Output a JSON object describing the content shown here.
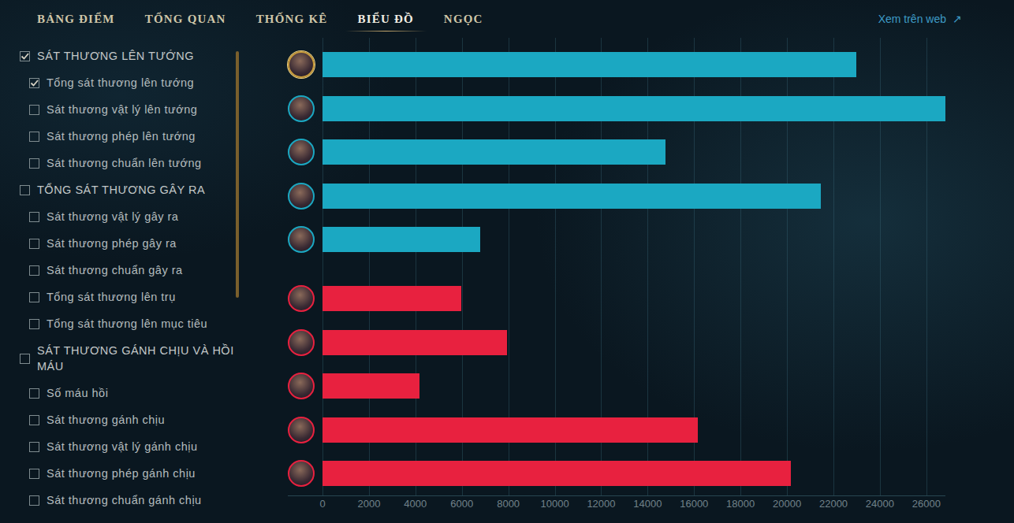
{
  "tabs": [
    {
      "label": "BẢNG ĐIỂM",
      "selected": false
    },
    {
      "label": "TỔNG QUAN",
      "selected": false
    },
    {
      "label": "THỐNG KÊ",
      "selected": false
    },
    {
      "label": "BIỂU ĐỒ",
      "selected": true
    },
    {
      "label": "NGỌC",
      "selected": false
    }
  ],
  "web_link": {
    "label": "Xem trên web",
    "icon": "↗"
  },
  "sidebar": {
    "items": [
      {
        "label": "SÁT THƯƠNG LÊN TƯỚNG",
        "kind": "group",
        "checked": true
      },
      {
        "label": "Tổng sát thương lên tướng",
        "kind": "item",
        "checked": true
      },
      {
        "label": "Sát thương vật lý lên tướng",
        "kind": "item",
        "checked": false
      },
      {
        "label": "Sát thương phép lên tướng",
        "kind": "item",
        "checked": false
      },
      {
        "label": "Sát thương chuẩn lên tướng",
        "kind": "item",
        "checked": false
      },
      {
        "label": "TỔNG SÁT THƯƠNG GÂY RA",
        "kind": "group",
        "checked": false
      },
      {
        "label": "Sát thương vật lý gây ra",
        "kind": "item",
        "checked": false
      },
      {
        "label": "Sát thương phép gây ra",
        "kind": "item",
        "checked": false
      },
      {
        "label": "Sát thương chuẩn gây ra",
        "kind": "item",
        "checked": false
      },
      {
        "label": "Tổng sát thương lên trụ",
        "kind": "item",
        "checked": false
      },
      {
        "label": "Tổng sát thương lên mục tiêu",
        "kind": "item",
        "checked": false
      },
      {
        "label": "SÁT THƯƠNG GÁNH CHỊU VÀ HỒI MÁU",
        "kind": "group",
        "checked": false
      },
      {
        "label": "Số máu hồi",
        "kind": "item",
        "checked": false
      },
      {
        "label": "Sát thương gánh chịu",
        "kind": "item",
        "checked": false
      },
      {
        "label": "Sát thương vật lý gánh chịu",
        "kind": "item",
        "checked": false
      },
      {
        "label": "Sát thương phép gánh chịu",
        "kind": "item",
        "checked": false
      },
      {
        "label": "Sát thương chuẩn gánh chịu",
        "kind": "item",
        "checked": false
      }
    ]
  },
  "chart": {
    "axis_max": 26820,
    "ticks": [
      "0",
      "2000",
      "4000",
      "6000",
      "8000",
      "10000",
      "12000",
      "14000",
      "16000",
      "18000",
      "20000",
      "22000",
      "24000",
      "26000"
    ],
    "series": [
      {
        "color": "#1ba8c2",
        "values": [
          23000,
          26820,
          14770,
          21440,
          6800
        ],
        "players": [
          {
            "highlighted": true
          },
          {
            "highlighted": false
          },
          {
            "highlighted": false
          },
          {
            "highlighted": false
          },
          {
            "highlighted": false
          }
        ]
      },
      {
        "color": "#e8213f",
        "values": [
          5990,
          7930,
          4190,
          16170,
          20150
        ],
        "players": [
          {
            "highlighted": false
          },
          {
            "highlighted": false
          },
          {
            "highlighted": false
          },
          {
            "highlighted": false
          },
          {
            "highlighted": false
          }
        ]
      }
    ]
  }
}
